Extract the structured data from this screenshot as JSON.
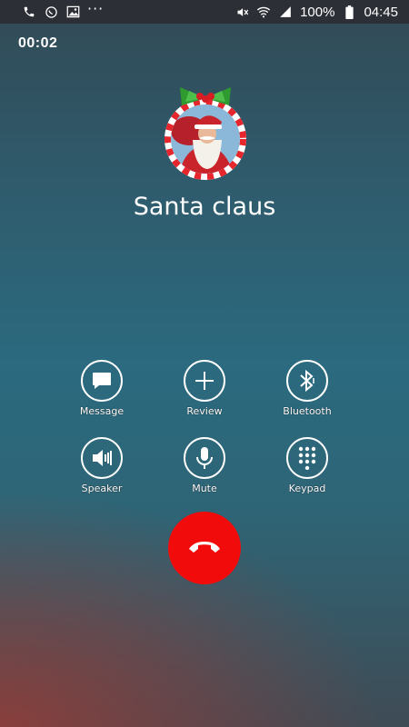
{
  "status_bar": {
    "battery": "100%",
    "time": "04:45",
    "left_icons": [
      "phone-icon",
      "whatsapp-icon",
      "image-icon",
      "more-icon"
    ],
    "right_icons": [
      "mute-icon",
      "wifi-icon",
      "signal-icon",
      "battery-icon"
    ]
  },
  "call": {
    "timer": "00:02",
    "contact_name": "Santa claus"
  },
  "actions": [
    {
      "label": "Message",
      "icon": "message-icon"
    },
    {
      "label": "Review",
      "icon": "plus-icon"
    },
    {
      "label": "Bluetooth",
      "icon": "bluetooth-icon"
    },
    {
      "label": "Speaker",
      "icon": "speaker-icon"
    },
    {
      "label": "Mute",
      "icon": "microphone-icon"
    },
    {
      "label": "Keypad",
      "icon": "keypad-icon"
    }
  ],
  "end_call": {
    "icon": "end-call-icon"
  },
  "colors": {
    "end_call": "#f20b0b",
    "status_bar": "#2c2f36",
    "ornament_stripe": "#e6262c",
    "bow": "#2f9a2e"
  }
}
